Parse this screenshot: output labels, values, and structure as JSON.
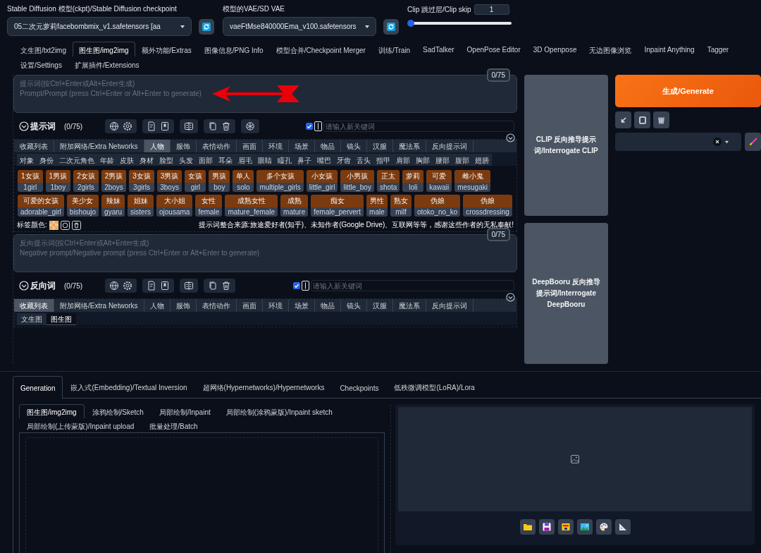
{
  "checkpoint": {
    "label": "Stable Diffusion 模型(ckpt)/Stable Diffusion checkpoint",
    "value": "05二次元萝莉facebombmix_v1.safetensors [aa"
  },
  "vae": {
    "label": "模型的VAE/SD VAE",
    "value": "vaeFtMse840000Ema_v100.safetensors"
  },
  "clip_skip": {
    "label": "Clip 跳过层/Clip skip",
    "value": "1",
    "level": 0
  },
  "main_tabs": [
    {
      "label": "文生图/txt2img",
      "selected": false
    },
    {
      "label": "图生图/img2img",
      "selected": true
    },
    {
      "label": "额外功能/Extras",
      "selected": false
    },
    {
      "label": "图像信息/PNG Info",
      "selected": false
    },
    {
      "label": "模型合并/Checkpoint Merger",
      "selected": false
    },
    {
      "label": "训练/Train",
      "selected": false
    },
    {
      "label": "SadTalker",
      "selected": false
    },
    {
      "label": "OpenPose Editor",
      "selected": false
    },
    {
      "label": "3D Openpose",
      "selected": false
    },
    {
      "label": "无边图像浏览",
      "selected": false
    },
    {
      "label": "Inpaint Anything",
      "selected": false
    },
    {
      "label": "Tagger",
      "selected": false
    },
    {
      "label": "设置/Settings",
      "selected": false
    },
    {
      "label": "扩展插件/Extensions",
      "selected": false
    }
  ],
  "prompt_sections": [
    {
      "counter": "0/75",
      "placeholder": "提示词(按Ctrl+Enter或Alt+Enter生成)\nPrompt/Prompt (press Ctrl+Enter or Alt+Enter to generate)",
      "title": "提示词",
      "count": "(0/75)",
      "keyword_checked": true,
      "keyword_placeholder": "请输入新关键词",
      "categories": [
        {
          "label": "收藏列表",
          "selected": false
        },
        {
          "label": "附加网络/Extra Networks",
          "selected": false
        },
        {
          "label": "人物",
          "selected": true
        },
        {
          "label": "服饰",
          "selected": false
        },
        {
          "label": "表情动作",
          "selected": false
        },
        {
          "label": "画面",
          "selected": false
        },
        {
          "label": "环境",
          "selected": false
        },
        {
          "label": "场景",
          "selected": false
        },
        {
          "label": "物品",
          "selected": false
        },
        {
          "label": "镜头",
          "selected": false
        },
        {
          "label": "汉服",
          "selected": false
        },
        {
          "label": "魔法系",
          "selected": false
        },
        {
          "label": "反向提示词",
          "selected": false
        }
      ],
      "subcategories": [
        {
          "label": "对象",
          "selected": false
        },
        {
          "label": "身份",
          "selected": false
        },
        {
          "label": "二次元角色",
          "selected": false
        },
        {
          "label": "年龄",
          "selected": false
        },
        {
          "label": "皮肤",
          "selected": false
        },
        {
          "label": "身材",
          "selected": false
        },
        {
          "label": "脸型",
          "selected": false
        },
        {
          "label": "头发",
          "selected": false
        },
        {
          "label": "面部",
          "selected": false
        },
        {
          "label": "耳朵",
          "selected": false
        },
        {
          "label": "眉毛",
          "selected": false
        },
        {
          "label": "眼睛",
          "selected": false
        },
        {
          "label": "瞳孔",
          "selected": false
        },
        {
          "label": "鼻子",
          "selected": false
        },
        {
          "label": "嘴巴",
          "selected": false
        },
        {
          "label": "牙齿",
          "selected": false
        },
        {
          "label": "舌头",
          "selected": false
        },
        {
          "label": "指甲",
          "selected": false
        },
        {
          "label": "肩部",
          "selected": false
        },
        {
          "label": "胸部",
          "selected": false
        },
        {
          "label": "腰部",
          "selected": false
        },
        {
          "label": "腹部",
          "selected": false
        },
        {
          "label": "翅膀",
          "selected": false
        }
      ],
      "tags": [
        {
          "zh": "1女孩",
          "en": "1girl"
        },
        {
          "zh": "1男孩",
          "en": "1boy"
        },
        {
          "zh": "2女孩",
          "en": "2girls"
        },
        {
          "zh": "2男孩",
          "en": "2boys"
        },
        {
          "zh": "3女孩",
          "en": "3girls"
        },
        {
          "zh": "3男孩",
          "en": "3boys"
        },
        {
          "zh": "女孩",
          "en": "girl"
        },
        {
          "zh": "男孩",
          "en": "boy"
        },
        {
          "zh": "单人",
          "en": "solo"
        },
        {
          "zh": "多个女孩",
          "en": "multiple_girls"
        },
        {
          "zh": "小女孩",
          "en": "little_girl"
        },
        {
          "zh": "小男孩",
          "en": "little_boy"
        },
        {
          "zh": "正太",
          "en": "shota"
        },
        {
          "zh": "萝莉",
          "en": "loli"
        },
        {
          "zh": "可爱",
          "en": "kawaii"
        },
        {
          "zh": "雌小鬼",
          "en": "mesugaki"
        },
        {
          "zh": "可爱的女孩",
          "en": "adorable_girl"
        },
        {
          "zh": "美少女",
          "en": "bishoujo"
        },
        {
          "zh": "辣妹",
          "en": "gyaru"
        },
        {
          "zh": "姐妹",
          "en": "sisters"
        },
        {
          "zh": "大小姐",
          "en": "ojousama"
        },
        {
          "zh": "女性",
          "en": "female"
        },
        {
          "zh": "成熟女性",
          "en": "mature_female"
        },
        {
          "zh": "成熟",
          "en": "mature"
        },
        {
          "zh": "痴女",
          "en": "female_pervert"
        },
        {
          "zh": "男性",
          "en": "male"
        },
        {
          "zh": "熟女",
          "en": "milf"
        },
        {
          "zh": "伪娘",
          "en": "otoko_no_ko"
        },
        {
          "zh": "伪娘",
          "en": "crossdressing"
        }
      ],
      "tag_color_label": "标签颜色:",
      "credit": "提示词整合来源:旅途爱好者(知乎)、未知作者(Google Drive)、互联网等等，感谢这些作者的无私奉献!"
    },
    {
      "counter": "0/75",
      "placeholder": "反向提示词(按Ctrl+Enter或Alt+Enter生成)\nNegative prompt/Negative prompt (press Ctrl+Enter or Alt+Enter to generate)",
      "title": "反向词",
      "count": "(0/75)",
      "keyword_checked": true,
      "keyword_placeholder": "请输入新关键词",
      "categories": [
        {
          "label": "收藏列表",
          "selected": true
        },
        {
          "label": "附加网络/Extra Networks",
          "selected": false
        },
        {
          "label": "人物",
          "selected": false
        },
        {
          "label": "服饰",
          "selected": false
        },
        {
          "label": "表情动作",
          "selected": false
        },
        {
          "label": "画面",
          "selected": false
        },
        {
          "label": "环境",
          "selected": false
        },
        {
          "label": "场景",
          "selected": false
        },
        {
          "label": "物品",
          "selected": false
        },
        {
          "label": "镜头",
          "selected": false
        },
        {
          "label": "汉服",
          "selected": false
        },
        {
          "label": "魔法系",
          "selected": false
        },
        {
          "label": "反向提示词",
          "selected": false
        }
      ],
      "subcategories": [
        {
          "label": "文生图",
          "selected": false
        },
        {
          "label": "图生图",
          "selected": true
        }
      ]
    }
  ],
  "interrogate_buttons": [
    "CLIP 反向推导提示词/Interrogate CLIP",
    "DeepBooru 反向推导提示词/Interrogate DeepBooru"
  ],
  "generate_button": "生成/Generate",
  "bottom_tabs": [
    {
      "label": "Generation",
      "selected": true
    },
    {
      "label": "嵌入式(Embedding)/Textual Inversion",
      "selected": false
    },
    {
      "label": "超网络(Hypernetworks)/Hypernetworks",
      "selected": false
    },
    {
      "label": "Checkpoints",
      "selected": false
    },
    {
      "label": "低秩微调模型(LoRA)/Lora",
      "selected": false
    }
  ],
  "img2img_tabs": [
    {
      "label": "图生图/img2img",
      "selected": true
    },
    {
      "label": "涂鸦绘制/Sketch",
      "selected": false
    },
    {
      "label": "局部绘制/Inpaint",
      "selected": false
    },
    {
      "label": "局部绘制(涂鸦蒙版)/Inpaint sketch",
      "selected": false
    },
    {
      "label": "局部绘制(上传蒙版)/Inpaint upload",
      "selected": false
    },
    {
      "label": "批量处理/Batch",
      "selected": false
    }
  ]
}
